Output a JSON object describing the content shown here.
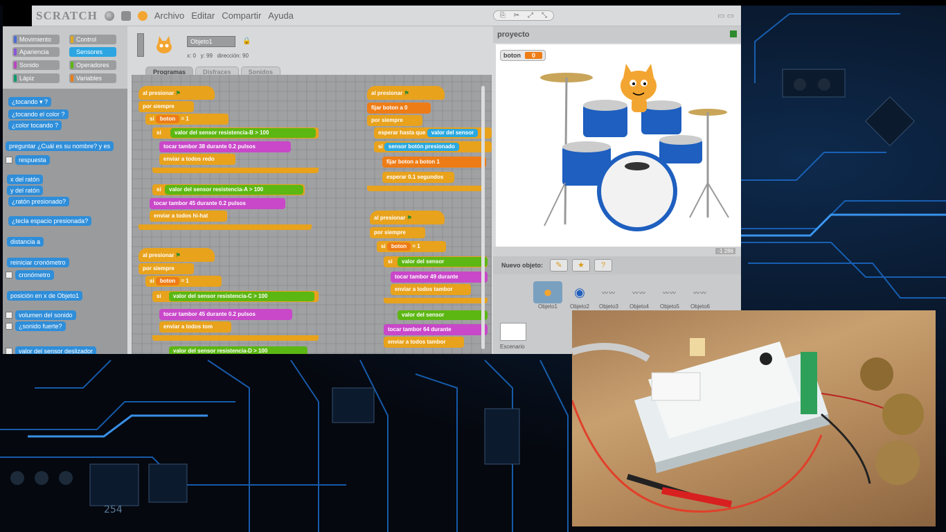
{
  "menubar": {
    "logo": "SCRATCH",
    "items": [
      "Archivo",
      "Editar",
      "Compartir",
      "Ayuda"
    ]
  },
  "palette": {
    "categories": [
      {
        "label": "Movimiento",
        "color": "#4a6cd4"
      },
      {
        "label": "Control",
        "color": "#e1a91a"
      },
      {
        "label": "Apariencia",
        "color": "#8a55d7"
      },
      {
        "label": "Sensores",
        "color": "#2ca5e2"
      },
      {
        "label": "Sonido",
        "color": "#bb42c3"
      },
      {
        "label": "Operadores",
        "color": "#5cb712"
      },
      {
        "label": "Lápiz",
        "color": "#0e9a6c"
      },
      {
        "label": "Variables",
        "color": "#ee7d16"
      }
    ],
    "blocks": [
      "¿tocando ▾ ?",
      "¿tocando el color ?",
      "¿color  tocando  ?",
      "preguntar ¿Cuál es su nombre? y es",
      "respuesta",
      "x del ratón",
      "y del ratón",
      "¿ratón presionado?",
      "¿tecla espacio presionada?",
      "distancia a",
      "reiniciar cronómetro",
      "cronómetro",
      "posición en x de Objeto1",
      "volumen del sonido",
      "¿sonido fuerte?",
      "valor del sensor deslizador"
    ]
  },
  "sprite": {
    "name": "Objeto1",
    "x": "x: 0",
    "y": "y: 99",
    "direction": "dirección: 90",
    "tabs": [
      "Programas",
      "Disfraces",
      "Sonidos"
    ]
  },
  "scripts": {
    "when_flag": "al presionar",
    "forever": "por siempre",
    "if": "si",
    "boton": "boton",
    "equals_val": "1",
    "sensor_value": "valor del sensor",
    "resistencia_a": "resistencia-A",
    "resistencia_b": "resistencia-B",
    "resistencia_c": "resistencia-C",
    "resistencia_d": "resistencia-D",
    "op_gt": ">",
    "val_100": "100",
    "tocar_tambor": "tocar tambor",
    "durante": "durante",
    "pulsos": "pulsos",
    "beats_02": "0.2",
    "drum_38": "38",
    "drum_45": "45",
    "drum_49": "49",
    "drum_64": "64",
    "enviar": "enviar a todos",
    "msg_redo": "redo",
    "msg_hihat": "hi-hat",
    "msg_tom": "tom",
    "msg_tambor": "tambor",
    "fijar": "fijar",
    "a": "a",
    "fijar_val_0": "0",
    "esperar": "esperar",
    "segundos": "segundos",
    "wait_val": "0.1",
    "esperar_hasta": "esperar hasta que",
    "sensor_boton": "sensor  botón presionado"
  },
  "stage": {
    "title": "proyecto",
    "monitor_label": "boton",
    "monitor_value": "0",
    "coords": "-1 286"
  },
  "sprites": {
    "new_label": "Nuevo objeto:",
    "stage_label": "Escenario",
    "items": [
      "Objeto1",
      "Objeto2",
      "Objeto3",
      "Objeto4",
      "Objeto5",
      "Objeto6"
    ]
  },
  "colors": {
    "control": "#e8a21c",
    "sensing": "#2aa8e0",
    "operators": "#5cb712",
    "sound": "#c947c9",
    "variables": "#ee7c16"
  }
}
